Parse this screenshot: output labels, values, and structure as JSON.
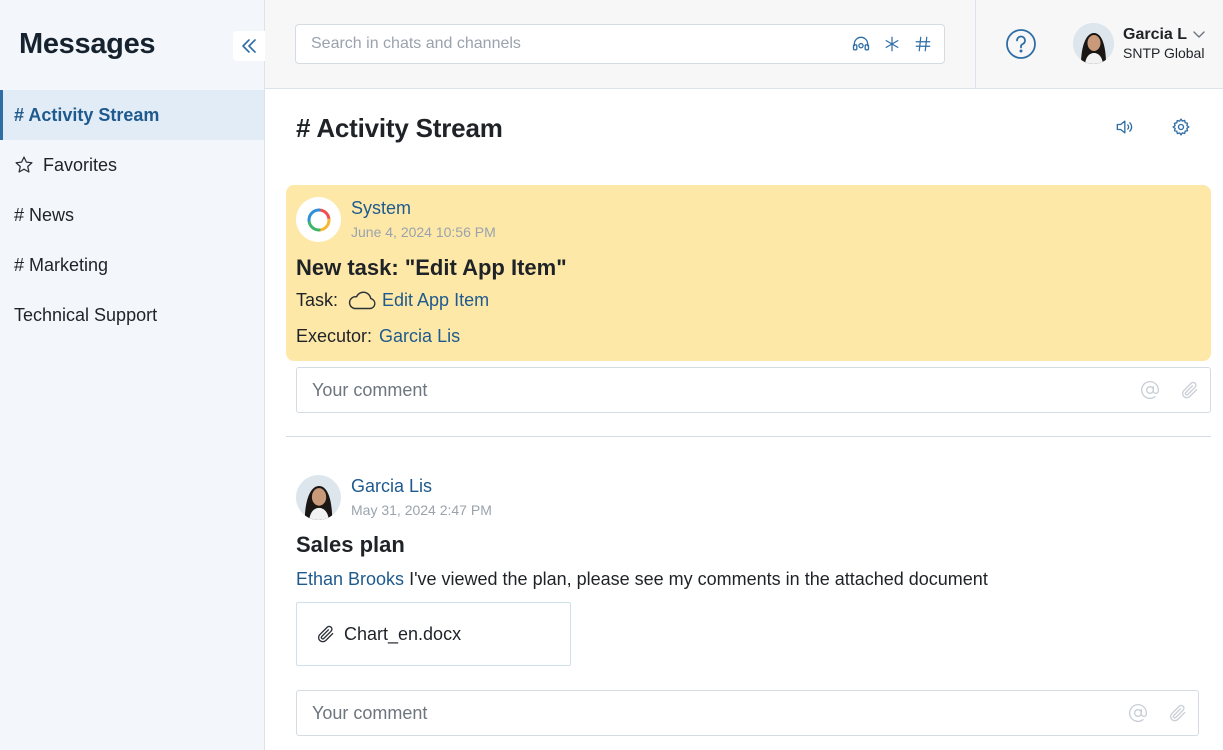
{
  "sidebar": {
    "title": "Messages",
    "items": [
      {
        "label": "# Activity Stream",
        "active": true
      },
      {
        "label": "Favorites",
        "icon": "star-icon"
      },
      {
        "label": "# News"
      },
      {
        "label": "# Marketing"
      },
      {
        "label": "Technical Support"
      }
    ]
  },
  "header": {
    "search_placeholder": "Search in chats and channels",
    "search_icons": [
      "headset-icon",
      "asterisk-icon",
      "hash-icon"
    ],
    "user": {
      "name": "Garcia L",
      "org": "SNTP Global"
    }
  },
  "main": {
    "title": "# Activity Stream",
    "posts": [
      {
        "author": "System",
        "date": "June 4, 2024 10:56 PM",
        "title": "New task: \"Edit App Item\"",
        "task_label": "Task:",
        "task_link": "Edit App Item",
        "executor_label": "Executor:",
        "executor_link": "Garcia Lis",
        "comment_placeholder": "Your comment"
      },
      {
        "author": "Garcia Lis",
        "date": "May 31, 2024 2:47 PM",
        "title": "Sales plan",
        "mention": "Ethan Brooks",
        "text": " I've viewed the plan, please see my comments in the attached document",
        "attachment": "Chart_en.docx",
        "comment_placeholder": "Your comment"
      }
    ]
  },
  "colors": {
    "accent": "#1f5a8e",
    "highlight": "#fde8a8",
    "sidebar_bg": "#f3f7fc",
    "active_item_bg": "#e2ecf6"
  }
}
